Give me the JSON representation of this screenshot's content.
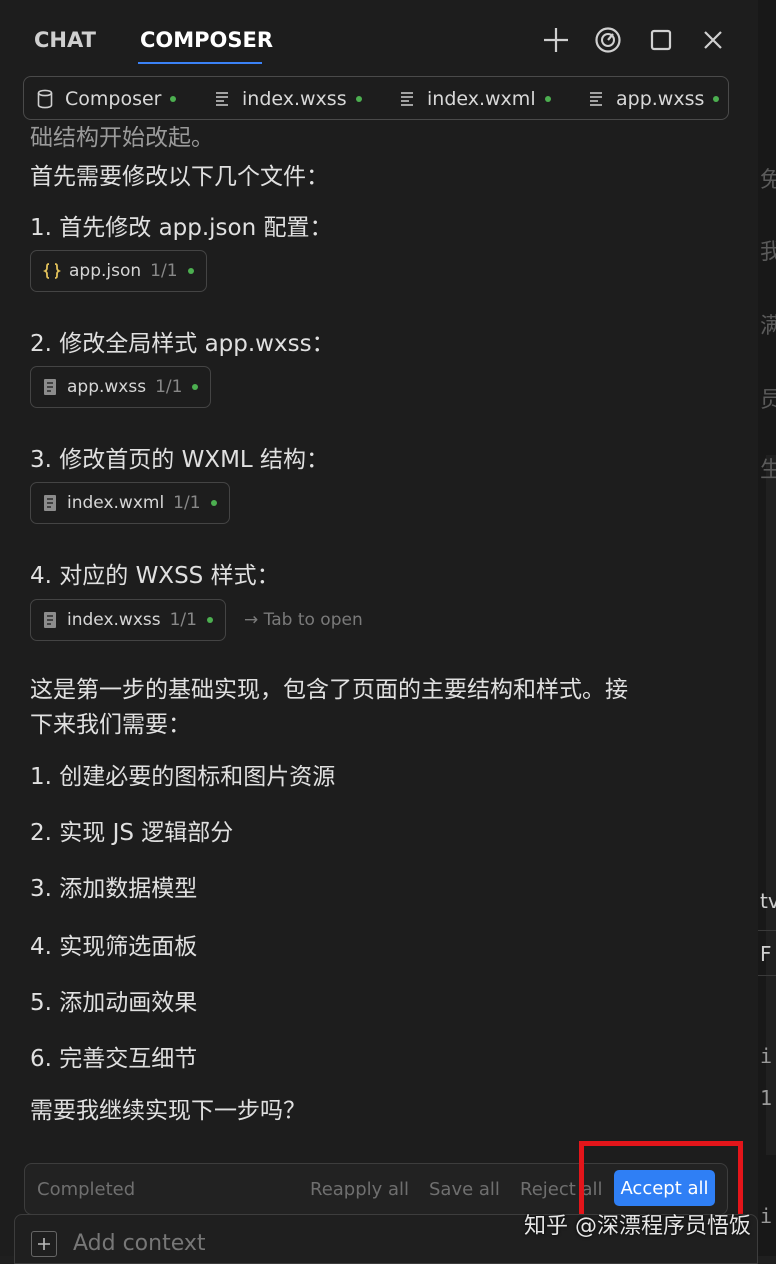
{
  "header": {
    "tab_chat": "CHAT",
    "tab_composer": "COMPOSER",
    "new_icon": "plus-icon",
    "history_icon": "speed-history-icon",
    "maximize_icon": "square-icon",
    "close_icon": "close-icon"
  },
  "file_tabs": [
    {
      "label": "Composer",
      "icon": "database-icon"
    },
    {
      "label": "index.wxss",
      "icon": "file-lines-icon"
    },
    {
      "label": "index.wxml",
      "icon": "file-lines-icon"
    },
    {
      "label": "app.wxss",
      "icon": "file-lines-icon"
    }
  ],
  "messages": {
    "cut_line": "础结构开始改起。",
    "intro": "首先需要修改以下几个文件：",
    "step1": "1. 首先修改 app.json 配置：",
    "step2": "2. 修改全局样式 app.wxss：",
    "step3": "3. 修改首页的 WXML 结构：",
    "step4": "4. 对应的 WXSS 样式：",
    "summary1": "这是第一步的基础实现，包含了页面的主要结构和样式。接",
    "summary2": "下来我们需要：",
    "todo1": "1. 创建必要的图标和图片资源",
    "todo2": "2. 实现 JS 逻辑部分",
    "todo3": "3. 添加数据模型",
    "todo4": "4. 实现筛选面板",
    "todo5": "5. 添加动画效果",
    "todo6": "6. 完善交互细节",
    "question": "需要我继续实现下一步吗？"
  },
  "chips": [
    {
      "name": "app.json",
      "count": "1/1",
      "icon": "braces-icon"
    },
    {
      "name": "app.wxss",
      "count": "1/1",
      "icon": "file-lines-icon"
    },
    {
      "name": "index.wxml",
      "count": "1/1",
      "icon": "file-lines-icon"
    },
    {
      "name": "index.wxss",
      "count": "1/1",
      "icon": "file-lines-icon"
    }
  ],
  "tab_hint": "→ Tab to open",
  "bottom_bar": {
    "status": "Completed",
    "reapply": "Reapply all",
    "save": "Save all",
    "reject": "Reject all",
    "accept": "Accept all"
  },
  "context": {
    "add_label": "Add context",
    "plus_icon": "plus-icon"
  },
  "watermark": "知乎 @深漂程序员悟饭",
  "right_strip": [
    "免",
    "我",
    "满",
    "员",
    "生",
    "tv",
    "F",
    "i",
    "1",
    "i"
  ],
  "colors": {
    "accent": "#2f7ff5",
    "status_dot": "#4caf50",
    "highlight_box": "#e3151a",
    "json_icon": "#e3c25b"
  }
}
